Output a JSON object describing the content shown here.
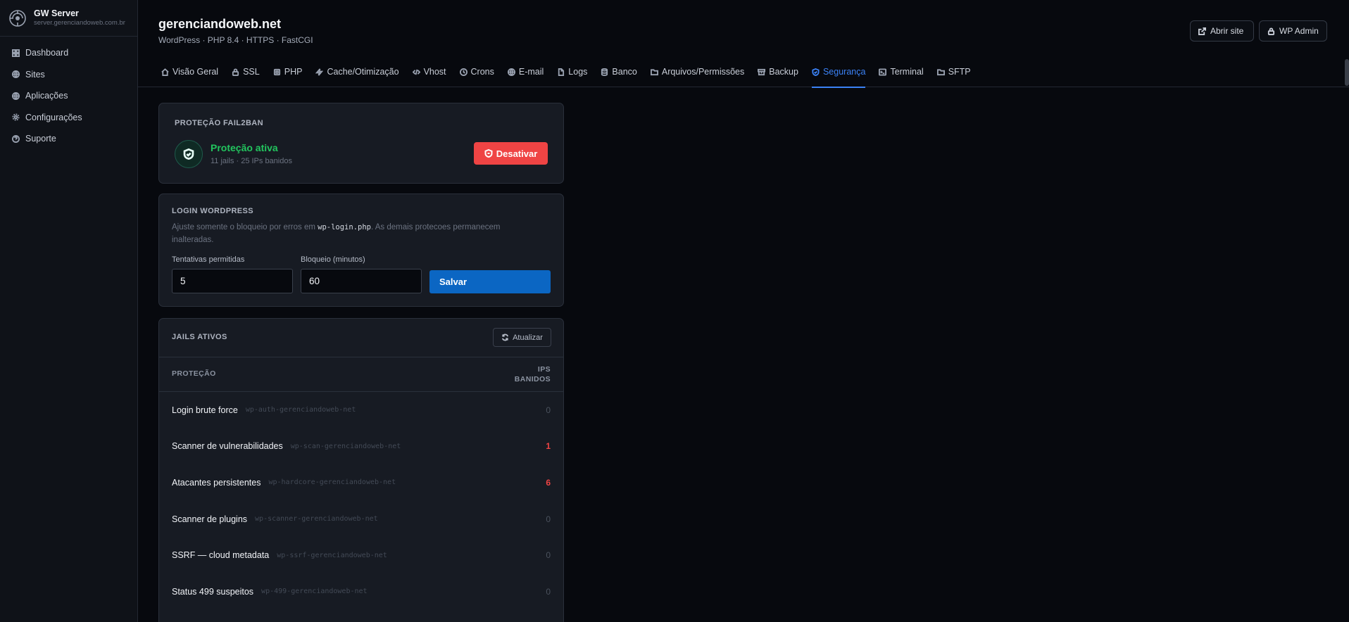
{
  "brand": {
    "name": "GW Server",
    "host": "server.gerenciandoweb.com.br"
  },
  "sidebar": {
    "items": [
      {
        "label": "Dashboard",
        "icon": "grid-icon"
      },
      {
        "label": "Sites",
        "icon": "globe-icon"
      },
      {
        "label": "Aplicações",
        "icon": "globe-icon"
      },
      {
        "label": "Configurações",
        "icon": "gear-icon"
      },
      {
        "label": "Suporte",
        "icon": "help-icon"
      }
    ]
  },
  "header": {
    "title": "gerenciandoweb.net",
    "subtitle": "WordPress · PHP 8.4 · HTTPS · FastCGI",
    "open_site_label": "Abrir site",
    "wp_admin_label": "WP Admin"
  },
  "tabs": [
    {
      "label": "Visão Geral"
    },
    {
      "label": "SSL"
    },
    {
      "label": "PHP"
    },
    {
      "label": "Cache/Otimização"
    },
    {
      "label": "Vhost"
    },
    {
      "label": "Crons"
    },
    {
      "label": "E-mail"
    },
    {
      "label": "Logs"
    },
    {
      "label": "Banco"
    },
    {
      "label": "Arquivos/Permissões"
    },
    {
      "label": "Backup"
    },
    {
      "label": "Segurança",
      "active": true
    },
    {
      "label": "Terminal"
    },
    {
      "label": "SFTP"
    }
  ],
  "fail2ban": {
    "label": "PROTEÇÃO FAIL2BAN",
    "status": "Proteção ativa",
    "meta": "11 jails · 25 IPs banidos",
    "disable_label": "Desativar"
  },
  "login": {
    "label": "LOGIN WORDPRESS",
    "desc_before": "Ajuste somente o bloqueio por erros em ",
    "desc_code": "wp-login.php",
    "desc_after": ". As demais protecoes permanecem inalteradas.",
    "attempts_label": "Tentativas permitidas",
    "attempts_value": "5",
    "block_label": "Bloqueio (minutos)",
    "block_value": "60",
    "save_label": "Salvar"
  },
  "jails": {
    "label": "JAILS ATIVOS",
    "refresh_label": "Atualizar",
    "col_protection": "PROTEÇÃO",
    "col_ips_1": "IPS",
    "col_ips_2": "BANIDOS",
    "rows": [
      {
        "name": "Login brute force",
        "id": "wp-auth-gerenciandoweb-net",
        "count": "0",
        "hot": false
      },
      {
        "name": "Scanner de vulnerabilidades",
        "id": "wp-scan-gerenciandoweb-net",
        "count": "1",
        "hot": true
      },
      {
        "name": "Atacantes persistentes",
        "id": "wp-hardcore-gerenciandoweb-net",
        "count": "6",
        "hot": true
      },
      {
        "name": "Scanner de plugins",
        "id": "wp-scanner-gerenciandoweb-net",
        "count": "0",
        "hot": false
      },
      {
        "name": "SSRF — cloud metadata",
        "id": "wp-ssrf-gerenciandoweb-net",
        "count": "0",
        "hot": false
      },
      {
        "name": "Status 499 suspeitos",
        "id": "wp-499-gerenciandoweb-net",
        "count": "0",
        "hot": false
      }
    ]
  },
  "colors": {
    "accent": "#3b82f6",
    "danger": "#ef4444",
    "success": "#22c55e",
    "primary": "#0b66c3"
  }
}
